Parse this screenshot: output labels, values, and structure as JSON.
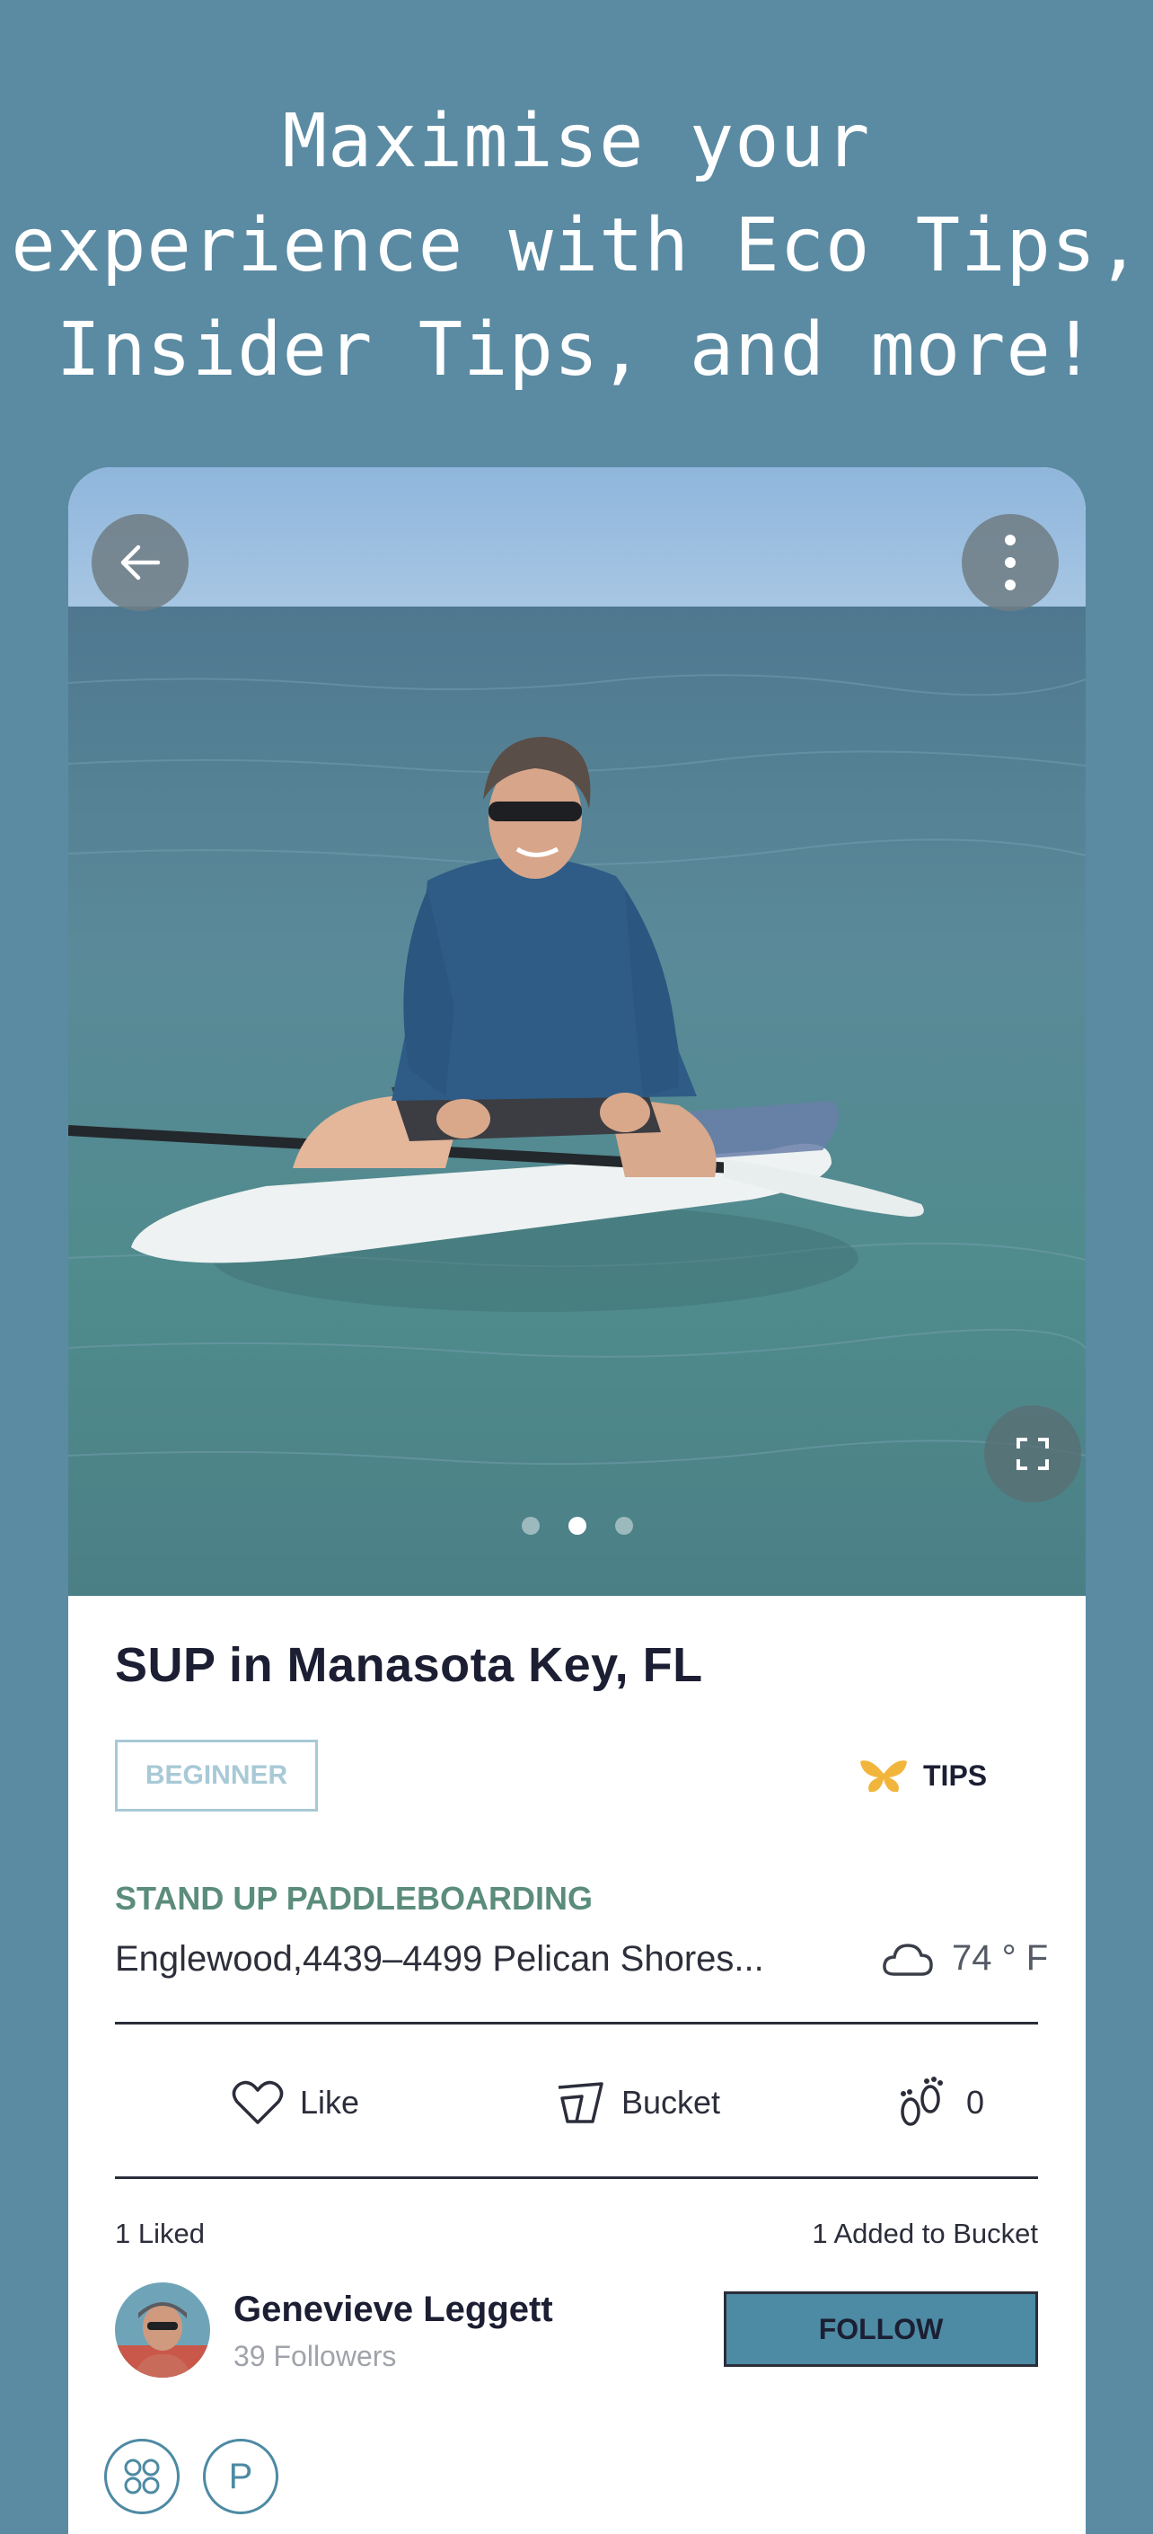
{
  "promo": {
    "headline_line1": "Maximise your",
    "headline_line2": "experience with Eco Tips,",
    "headline_line3": "Insider Tips, and more!"
  },
  "gallery": {
    "image": "man-sitting-on-paddleboard-photo",
    "page_count": 3,
    "active_page": 2
  },
  "activity": {
    "title": "SUP in Manasota Key, FL",
    "level": "BEGINNER",
    "tips_label": "TIPS",
    "category": "STAND UP PADDLEBOARDING",
    "address": "Englewood,4439–4499 Pelican Shores...",
    "temperature": "74 ° F"
  },
  "actions": {
    "like_label": "Like",
    "bucket_label": "Bucket",
    "footprints_count": "0"
  },
  "stats": {
    "liked": "1 Liked",
    "added": "1 Added to Bucket"
  },
  "author": {
    "name": "Genevieve Leggett",
    "followers": "39 Followers",
    "follow_label": "FOLLOW"
  },
  "bottom_icons": {
    "group_icon": "group-icon",
    "parking_label": "P"
  },
  "colors": {
    "background": "#5b8ba3",
    "accent": "#4d8aa3",
    "category": "#5b8c7c",
    "tips_icon": "#f2b53c"
  }
}
